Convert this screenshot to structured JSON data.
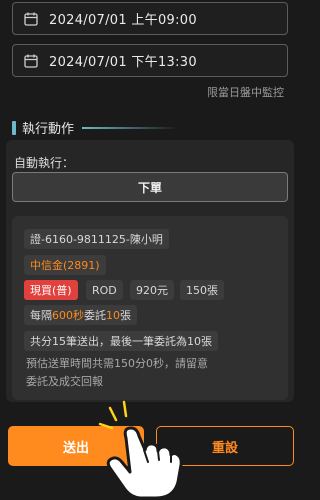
{
  "date_range": {
    "start": "2024/07/01  上午09:00",
    "end": "2024/07/01  下午13:30",
    "note": "限當日盤中監控"
  },
  "section": {
    "title": "執行動作"
  },
  "auto_exec": {
    "label": "自動執行：",
    "action": "下單"
  },
  "order": {
    "account": "證-6160-9811125-陳小明",
    "stock": "中信金(2891)",
    "trade_type": "現買(普)",
    "condition": "ROD",
    "price": "920元",
    "quantity": "150張",
    "interval_prefix": "每隔",
    "interval_value": "600秒",
    "interval_mid": "委託",
    "interval_qty": "10",
    "interval_suffix": "張",
    "summary": "共分15筆送出，最後一筆委託為10張",
    "estimate_line1": "預估送單時間共需150分0秒，請留意",
    "estimate_line2": "委託及成交回報"
  },
  "buttons": {
    "send": "送出",
    "reset": "重設"
  },
  "colors": {
    "accent": "#ff8a1e",
    "buy": "#e0413c",
    "section_bar": "#6fb7c8"
  },
  "icons": [
    "calendar-icon",
    "pointing-hand-icon"
  ]
}
